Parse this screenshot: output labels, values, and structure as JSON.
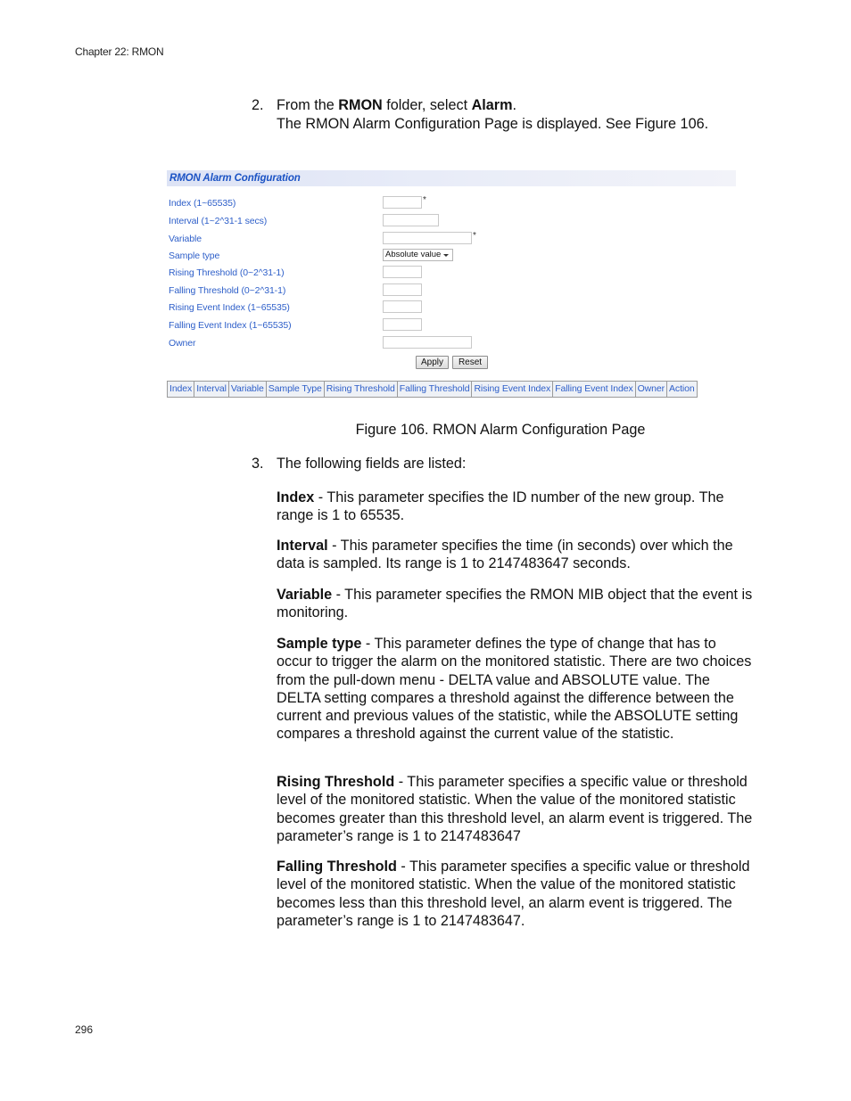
{
  "running_header": "Chapter 22: RMON",
  "page_number": "296",
  "step2": {
    "number": "2.",
    "line1_prefix": "From the ",
    "line1_bold1": "RMON",
    "line1_middle": " folder, select ",
    "line1_bold2": "Alarm",
    "line1_suffix": ".",
    "line2": "The RMON Alarm Configuration Page is displayed. See Figure 106."
  },
  "figure": {
    "panel_title": "RMON Alarm Configuration",
    "fields": [
      {
        "label": "Index (1~65535)",
        "value": "",
        "required": "*"
      },
      {
        "label": "Interval (1~2^31-1 secs)",
        "value": ""
      },
      {
        "label": "Variable",
        "value": "",
        "required": "*"
      },
      {
        "label": "Sample type",
        "selected": "Absolute value"
      },
      {
        "label": "Rising Threshold (0~2^31-1)",
        "value": ""
      },
      {
        "label": "Falling Threshold (0~2^31-1)",
        "value": ""
      },
      {
        "label": "Rising Event Index (1~65535)",
        "value": ""
      },
      {
        "label": "Falling Event Index (1~65535)",
        "value": ""
      },
      {
        "label": "Owner",
        "value": ""
      }
    ],
    "buttons": {
      "apply": "Apply",
      "reset": "Reset"
    },
    "table_headers": [
      "Index",
      "Interval",
      "Variable",
      "Sample Type",
      "Rising Threshold",
      "Falling Threshold",
      "Rising Event Index",
      "Falling Event Index",
      "Owner",
      "Action"
    ]
  },
  "caption": "Figure 106. RMON Alarm Configuration Page",
  "step3": {
    "number": "3.",
    "text": "The following fields are listed:"
  },
  "descriptions": [
    {
      "term": "Index",
      "text": " - This parameter specifies the ID number of the new group. The range is 1 to 65535."
    },
    {
      "term": "Interval",
      "text": " - This parameter specifies the time (in seconds) over which the data is sampled. Its range is 1 to 2147483647 seconds."
    },
    {
      "term": "Variable",
      "text": " - This parameter specifies the RMON MIB object that the event is monitoring."
    },
    {
      "term": "Sample type",
      "text": " - This parameter defines the type of change that has to occur to trigger the alarm on the monitored statistic. There are two choices from the pull-down menu - DELTA value and ABSOLUTE value. The DELTA setting compares a threshold against the difference between the current and previous values of the statistic, while the ABSOLUTE setting compares a threshold against the current value of the statistic."
    },
    {
      "term": "Rising Threshold",
      "text": " - This parameter specifies a specific value or threshold level of the monitored statistic. When the value of the monitored statistic becomes greater than this threshold level, an alarm event is triggered. The parameter’s range is 1 to 2147483647"
    },
    {
      "term": "Falling Threshold",
      "text": " - This parameter specifies a specific value or threshold level of the monitored statistic. When the value of the monitored statistic becomes less than this threshold level, an alarm event is triggered. The parameter’s range is 1 to 2147483647."
    }
  ]
}
